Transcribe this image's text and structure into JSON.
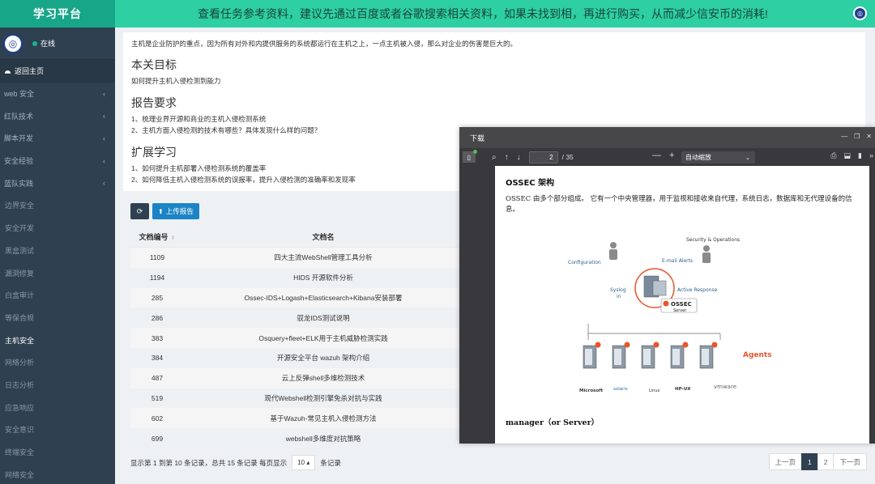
{
  "app": {
    "title": "学习平台"
  },
  "banner": {
    "text": "查看任务参考资料，建议先通过百度或者谷歌搜索相关资料，如果未找到相，再进行购买，从而减少信安币的消耗!"
  },
  "user": {
    "status": "在线"
  },
  "sidebar": {
    "home": "返回主页",
    "groups": [
      "web 安全",
      "红队技术",
      "脚本开发",
      "安全经验",
      "蓝队实践"
    ],
    "sub_items": [
      "边界安全",
      "安全开发",
      "黑盒测试",
      "漏洞修复",
      "白盒审计",
      "等保合规",
      "主机安全",
      "网络分析",
      "日志分析",
      "应急响应",
      "安全意识",
      "终端安全",
      "网络安全"
    ]
  },
  "card": {
    "intro": "主机是企业防护的重点，因为所有对外和内提供服务的系统都运行在主机之上，一点主机被入侵，那么对企业的伤害是巨大的。",
    "goal_title": "本关目标",
    "goal_text": "如何提升主机入侵检测到能力",
    "req_title": "报告要求",
    "req_1": "1、梳理业界开源和商业的主机入侵检测系统",
    "req_2": "2、主机方面入侵检测的技术有哪些？具体发现什么样的问题？",
    "ext_title": "扩展学习",
    "ext_1": "1、如何提升主机部署入侵检测系统的覆盖率",
    "ext_2": "2、如何降低主机入侵检测系统的误报率，提升入侵检测的准确率和发现率"
  },
  "toolbar": {
    "upload_label": "上传报告"
  },
  "table": {
    "headers": {
      "id": "文档编号",
      "name": "文档名"
    },
    "rows": [
      {
        "id": "1109",
        "name": "四大主流WebShell管理工具分析"
      },
      {
        "id": "1194",
        "name": "HIDS 开源软件分析"
      },
      {
        "id": "285",
        "name": "Ossec-IDS+Logash+Elasticsearch+Kibana安装部署"
      },
      {
        "id": "286",
        "name": "驭龙IDS测试说明"
      },
      {
        "id": "383",
        "name": "Osquery+fleet+ELK用于主机威胁检测实践"
      },
      {
        "id": "384",
        "name": "开源安全平台 wazuh 架构介绍"
      },
      {
        "id": "487",
        "name": "云上反弹shell多维检测技术"
      },
      {
        "id": "519",
        "name": "现代Webshell检测引擎免杀对抗与实践"
      },
      {
        "id": "602",
        "name": "基于Wazuh-常见主机入侵检测方法"
      },
      {
        "id": "699",
        "name": "webshell多维度对抗策略"
      }
    ]
  },
  "footer": {
    "info_prefix": "显示第 1 到第 10 条记录，总共 15 条记录 每页显示",
    "page_size": "10",
    "info_suffix": "条记录"
  },
  "pager": {
    "prev": "上一页",
    "p1": "1",
    "p2": "2",
    "next": "下一页"
  },
  "viewer": {
    "title": "下载",
    "page_current": "2",
    "page_total": "/ 35",
    "zoom": "自动缩放",
    "heading": "OSSEC 架构",
    "paragraph": "OSSEC 由多个部分组成。 它有一个中央管理器，用于监视和接收来自代理，系统日志，数据库和无代理设备的信息。",
    "diagram": {
      "security_ops": "Security & Operations",
      "configuration": "Configuration",
      "email_alerts": "E-mail Alerts",
      "syslog": "Syslog",
      "syslog2": "in",
      "active_response": "Active Response",
      "ossec": "OSSEC",
      "server": "Server",
      "agents": "Agents",
      "vendors": [
        "Microsoft",
        "solaris",
        "Linux",
        "HP-UX",
        "vmware"
      ]
    },
    "subheading": "manager（or Server）"
  },
  "colors": {
    "brand": "#18a689",
    "banner": "#2ecfa3",
    "sidebar": "#2f4050",
    "agents": "#e8542b"
  }
}
